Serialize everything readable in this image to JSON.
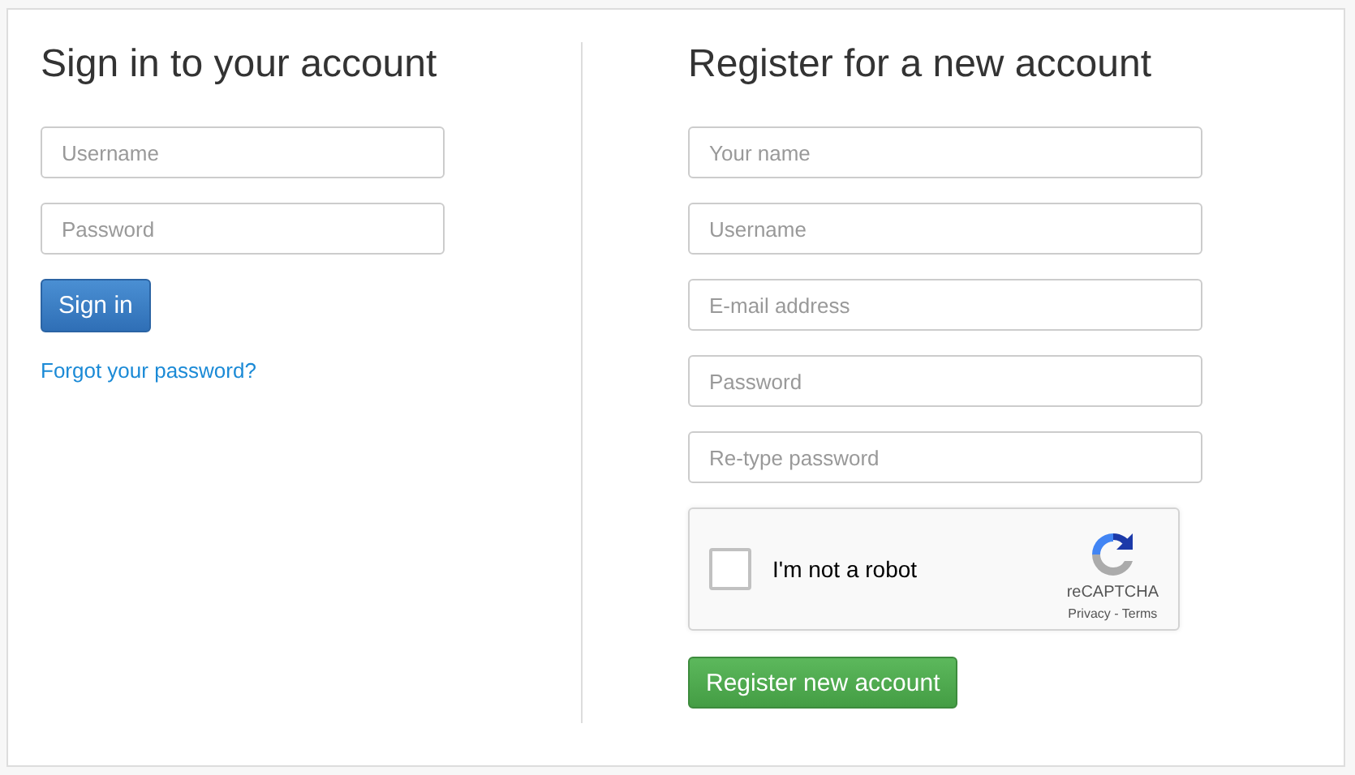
{
  "sign_in": {
    "title": "Sign in to your account",
    "fields": [
      {
        "placeholder": "Username"
      },
      {
        "placeholder": "Password"
      }
    ],
    "button": "Sign in",
    "forgot_link": "Forgot your password?"
  },
  "register": {
    "title": "Register for a new account",
    "fields": [
      {
        "placeholder": "Your name"
      },
      {
        "placeholder": "Username"
      },
      {
        "placeholder": "E-mail address"
      },
      {
        "placeholder": "Password"
      },
      {
        "placeholder": "Re-type password"
      }
    ],
    "captcha": {
      "label": "I'm not a robot",
      "checked": false,
      "brand": "reCAPTCHA",
      "links": "Privacy - Terms"
    },
    "button": "Register new account"
  }
}
